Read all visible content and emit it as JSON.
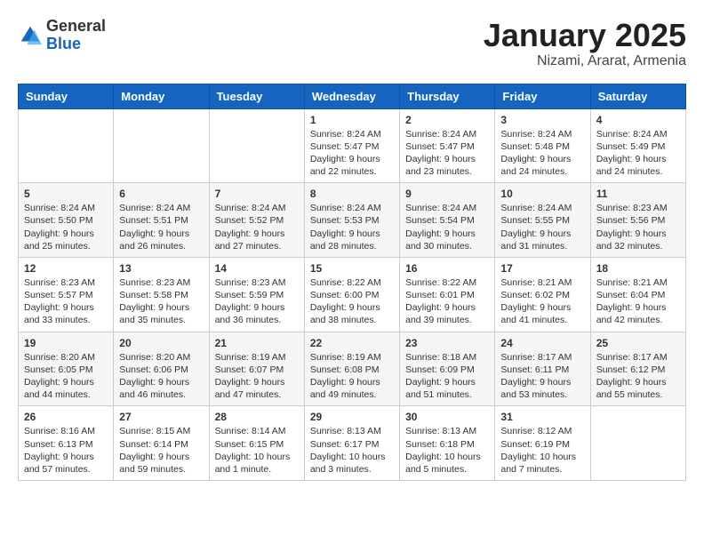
{
  "header": {
    "logo": {
      "general": "General",
      "blue": "Blue"
    },
    "title": "January 2025",
    "location": "Nizami, Ararat, Armenia"
  },
  "weekdays": [
    "Sunday",
    "Monday",
    "Tuesday",
    "Wednesday",
    "Thursday",
    "Friday",
    "Saturday"
  ],
  "weeks": [
    [
      {
        "day": "",
        "info": ""
      },
      {
        "day": "",
        "info": ""
      },
      {
        "day": "",
        "info": ""
      },
      {
        "day": "1",
        "info": "Sunrise: 8:24 AM\nSunset: 5:47 PM\nDaylight: 9 hours\nand 22 minutes."
      },
      {
        "day": "2",
        "info": "Sunrise: 8:24 AM\nSunset: 5:47 PM\nDaylight: 9 hours\nand 23 minutes."
      },
      {
        "day": "3",
        "info": "Sunrise: 8:24 AM\nSunset: 5:48 PM\nDaylight: 9 hours\nand 24 minutes."
      },
      {
        "day": "4",
        "info": "Sunrise: 8:24 AM\nSunset: 5:49 PM\nDaylight: 9 hours\nand 24 minutes."
      }
    ],
    [
      {
        "day": "5",
        "info": "Sunrise: 8:24 AM\nSunset: 5:50 PM\nDaylight: 9 hours\nand 25 minutes."
      },
      {
        "day": "6",
        "info": "Sunrise: 8:24 AM\nSunset: 5:51 PM\nDaylight: 9 hours\nand 26 minutes."
      },
      {
        "day": "7",
        "info": "Sunrise: 8:24 AM\nSunset: 5:52 PM\nDaylight: 9 hours\nand 27 minutes."
      },
      {
        "day": "8",
        "info": "Sunrise: 8:24 AM\nSunset: 5:53 PM\nDaylight: 9 hours\nand 28 minutes."
      },
      {
        "day": "9",
        "info": "Sunrise: 8:24 AM\nSunset: 5:54 PM\nDaylight: 9 hours\nand 30 minutes."
      },
      {
        "day": "10",
        "info": "Sunrise: 8:24 AM\nSunset: 5:55 PM\nDaylight: 9 hours\nand 31 minutes."
      },
      {
        "day": "11",
        "info": "Sunrise: 8:23 AM\nSunset: 5:56 PM\nDaylight: 9 hours\nand 32 minutes."
      }
    ],
    [
      {
        "day": "12",
        "info": "Sunrise: 8:23 AM\nSunset: 5:57 PM\nDaylight: 9 hours\nand 33 minutes."
      },
      {
        "day": "13",
        "info": "Sunrise: 8:23 AM\nSunset: 5:58 PM\nDaylight: 9 hours\nand 35 minutes."
      },
      {
        "day": "14",
        "info": "Sunrise: 8:23 AM\nSunset: 5:59 PM\nDaylight: 9 hours\nand 36 minutes."
      },
      {
        "day": "15",
        "info": "Sunrise: 8:22 AM\nSunset: 6:00 PM\nDaylight: 9 hours\nand 38 minutes."
      },
      {
        "day": "16",
        "info": "Sunrise: 8:22 AM\nSunset: 6:01 PM\nDaylight: 9 hours\nand 39 minutes."
      },
      {
        "day": "17",
        "info": "Sunrise: 8:21 AM\nSunset: 6:02 PM\nDaylight: 9 hours\nand 41 minutes."
      },
      {
        "day": "18",
        "info": "Sunrise: 8:21 AM\nSunset: 6:04 PM\nDaylight: 9 hours\nand 42 minutes."
      }
    ],
    [
      {
        "day": "19",
        "info": "Sunrise: 8:20 AM\nSunset: 6:05 PM\nDaylight: 9 hours\nand 44 minutes."
      },
      {
        "day": "20",
        "info": "Sunrise: 8:20 AM\nSunset: 6:06 PM\nDaylight: 9 hours\nand 46 minutes."
      },
      {
        "day": "21",
        "info": "Sunrise: 8:19 AM\nSunset: 6:07 PM\nDaylight: 9 hours\nand 47 minutes."
      },
      {
        "day": "22",
        "info": "Sunrise: 8:19 AM\nSunset: 6:08 PM\nDaylight: 9 hours\nand 49 minutes."
      },
      {
        "day": "23",
        "info": "Sunrise: 8:18 AM\nSunset: 6:09 PM\nDaylight: 9 hours\nand 51 minutes."
      },
      {
        "day": "24",
        "info": "Sunrise: 8:17 AM\nSunset: 6:11 PM\nDaylight: 9 hours\nand 53 minutes."
      },
      {
        "day": "25",
        "info": "Sunrise: 8:17 AM\nSunset: 6:12 PM\nDaylight: 9 hours\nand 55 minutes."
      }
    ],
    [
      {
        "day": "26",
        "info": "Sunrise: 8:16 AM\nSunset: 6:13 PM\nDaylight: 9 hours\nand 57 minutes."
      },
      {
        "day": "27",
        "info": "Sunrise: 8:15 AM\nSunset: 6:14 PM\nDaylight: 9 hours\nand 59 minutes."
      },
      {
        "day": "28",
        "info": "Sunrise: 8:14 AM\nSunset: 6:15 PM\nDaylight: 10 hours\nand 1 minute."
      },
      {
        "day": "29",
        "info": "Sunrise: 8:13 AM\nSunset: 6:17 PM\nDaylight: 10 hours\nand 3 minutes."
      },
      {
        "day": "30",
        "info": "Sunrise: 8:13 AM\nSunset: 6:18 PM\nDaylight: 10 hours\nand 5 minutes."
      },
      {
        "day": "31",
        "info": "Sunrise: 8:12 AM\nSunset: 6:19 PM\nDaylight: 10 hours\nand 7 minutes."
      },
      {
        "day": "",
        "info": ""
      }
    ]
  ]
}
